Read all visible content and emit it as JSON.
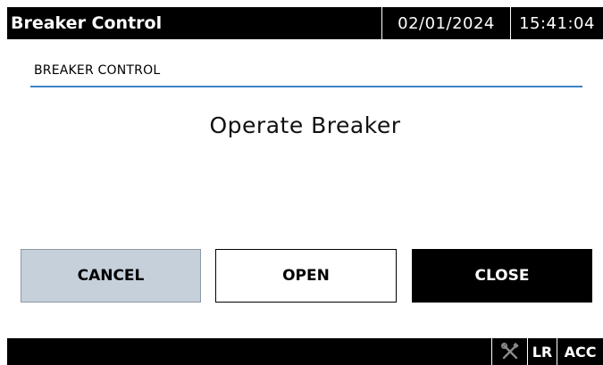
{
  "titlebar": {
    "title": "Breaker Control",
    "date": "02/01/2024",
    "time": "15:41:04"
  },
  "section": {
    "label": "BREAKER CONTROL"
  },
  "prompt": "Operate Breaker",
  "buttons": {
    "cancel": "CANCEL",
    "open": "OPEN",
    "close": "CLOSE"
  },
  "statusbar": {
    "tools_icon": "crossed-tools-icon",
    "lr": "LR",
    "acc": "ACC"
  },
  "colors": {
    "bar_background": "#000000",
    "section_rule": "#3b82c4",
    "cancel_background": "#c6d0da"
  }
}
